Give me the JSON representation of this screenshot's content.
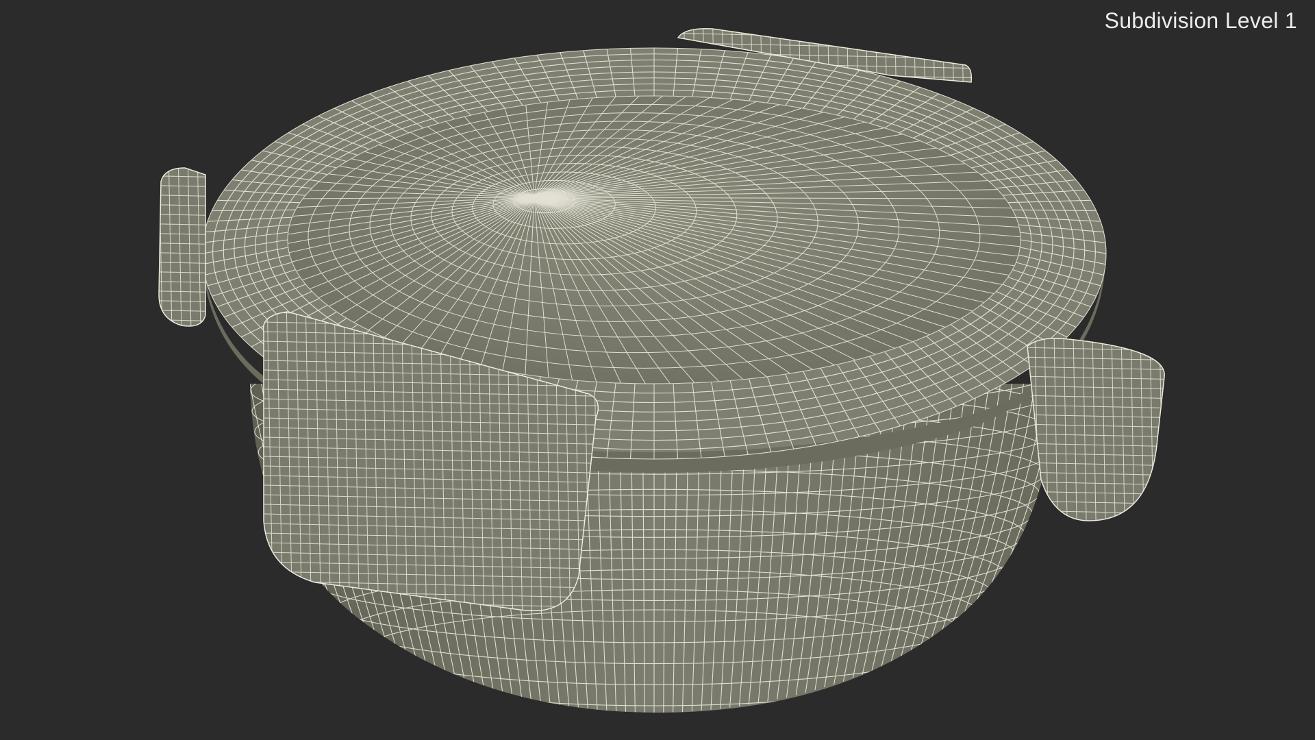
{
  "viewport": {
    "label": "Subdivision Level 1",
    "background_color": "#2b2b2b"
  },
  "model": {
    "subject": "round food container with locking lid, wireframe render",
    "surface_color": "#7b7b6d",
    "surface_shadow_color": "#5f5f53",
    "wire_color": "#ecebdd",
    "clip_count": 4
  }
}
